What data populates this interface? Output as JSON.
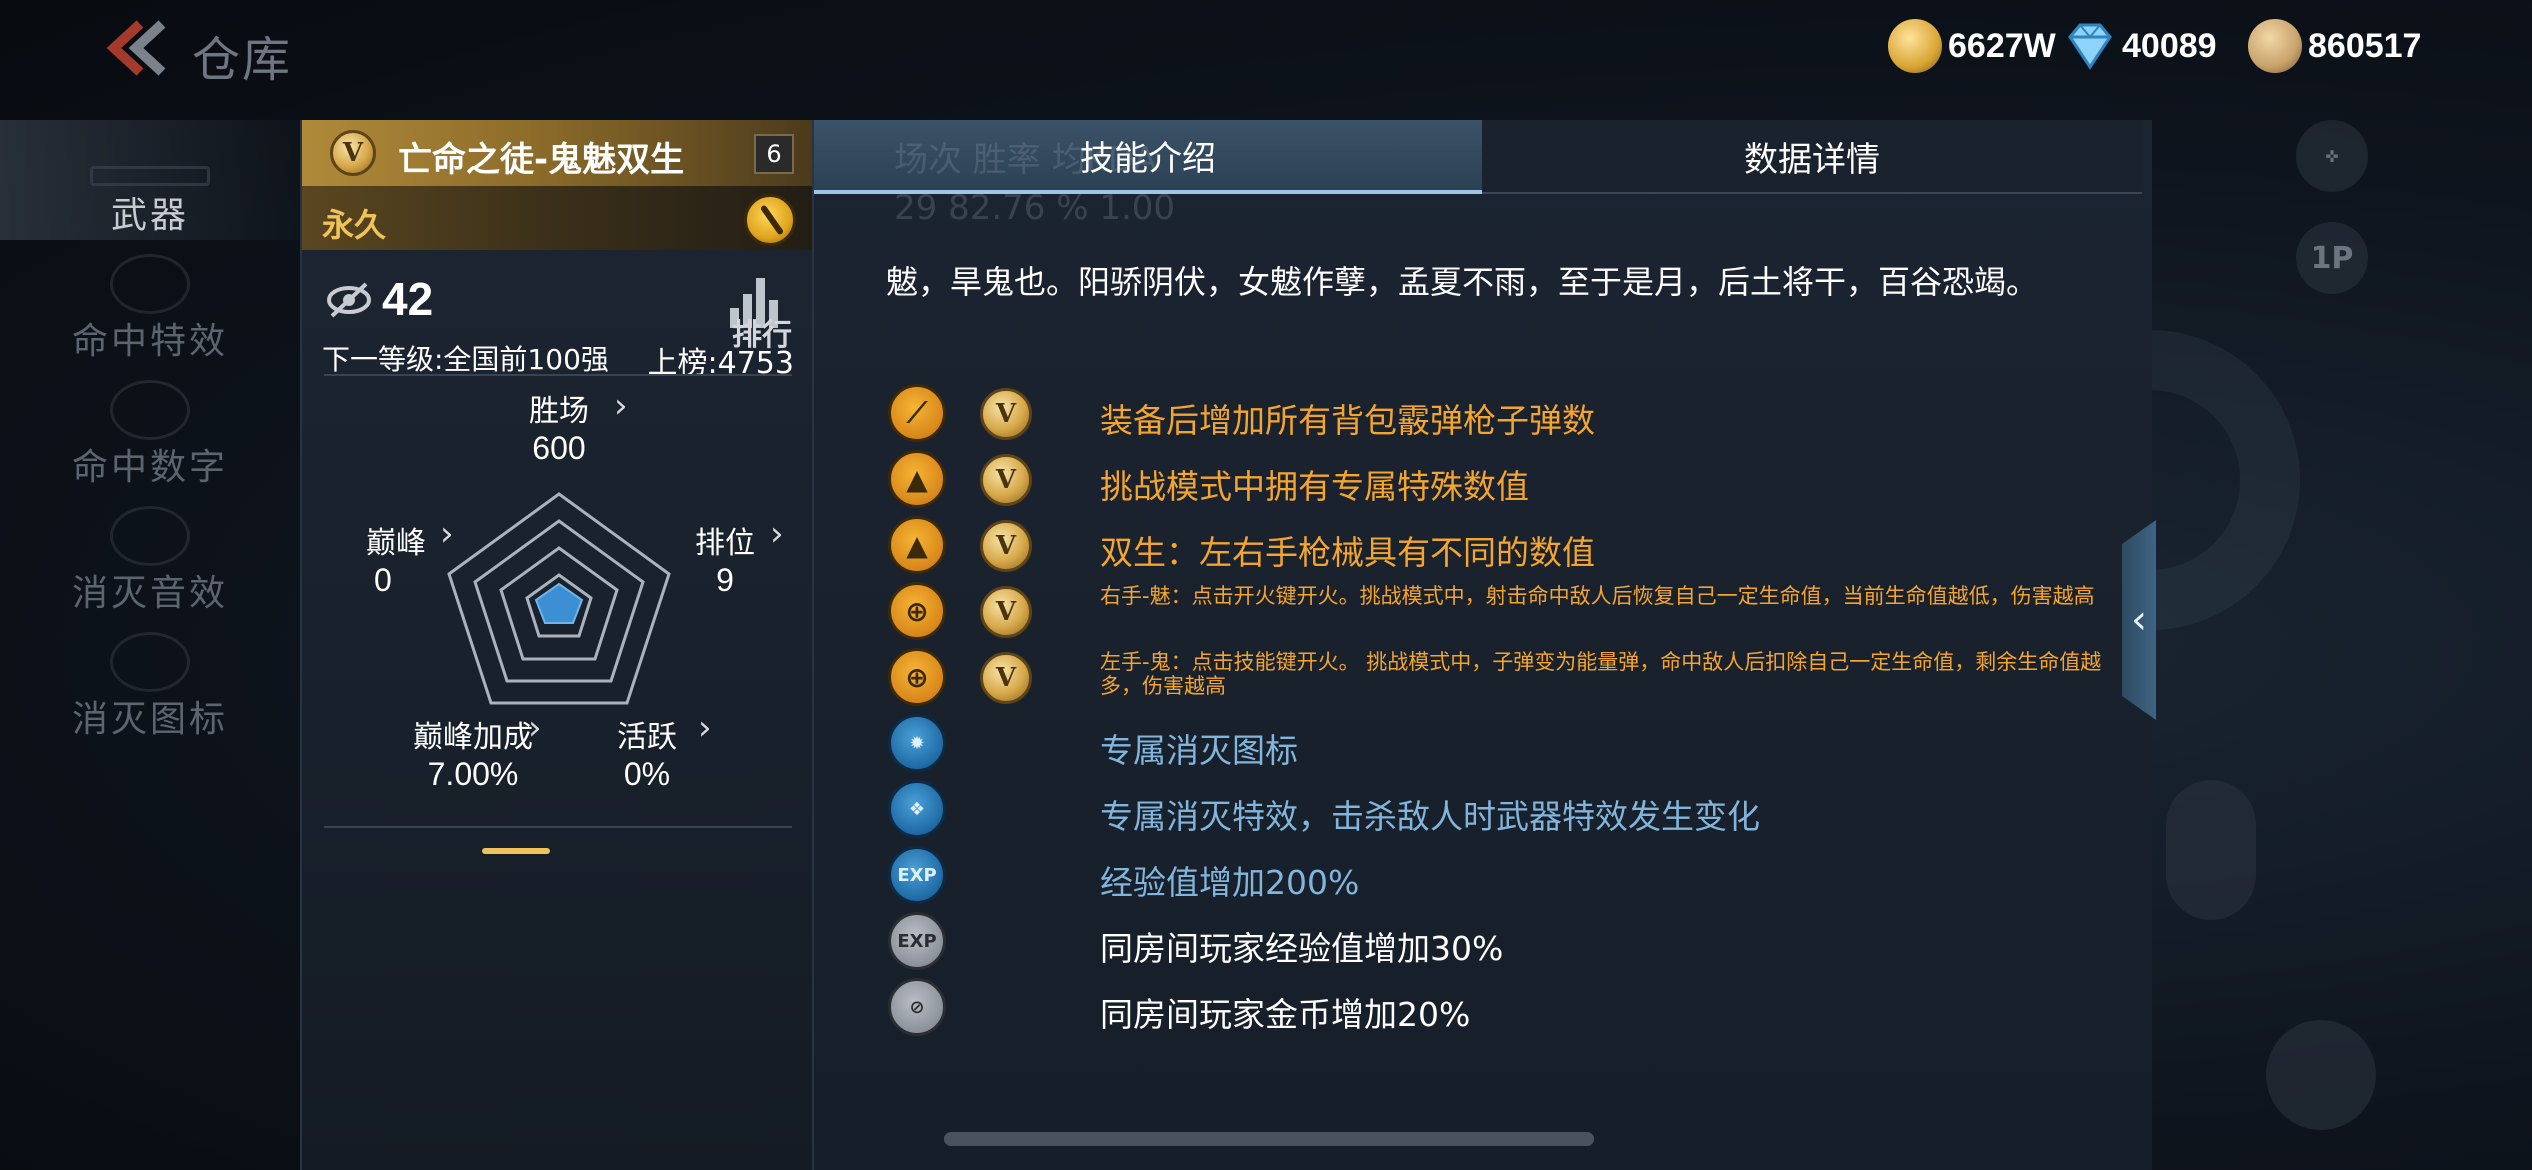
{
  "topbar": {
    "title": "仓库",
    "currencies": [
      {
        "name": "gold",
        "value": "6627W",
        "color": "#d9a636"
      },
      {
        "name": "diamond",
        "value": "40089",
        "color": "#6fc6f4"
      },
      {
        "name": "coin",
        "value": "860517",
        "color": "#c8a26b"
      }
    ]
  },
  "leftnav": {
    "items": [
      {
        "label": "武器"
      },
      {
        "label": "命中特效"
      },
      {
        "label": "命中数字"
      },
      {
        "label": "消灭音效"
      },
      {
        "label": "消灭图标"
      }
    ]
  },
  "card": {
    "badge": "V",
    "name": "亡命之徒-鬼魅双生",
    "level": "6",
    "duration": "永久",
    "rank_score": "42",
    "rank_label": "排行",
    "next_level": "下一等级:全国前100强",
    "on_board": "上榜:4753",
    "radar": {
      "wins": {
        "label": "胜场",
        "value": "600"
      },
      "peak": {
        "label": "巅峰",
        "value": "0"
      },
      "position": {
        "label": "排位",
        "value": "9"
      },
      "peak_bonus": {
        "label": "巅峰加成",
        "value": "7.00%"
      },
      "active": {
        "label": "活跃",
        "value": "0%"
      }
    }
  },
  "panel": {
    "tabs": [
      {
        "label": "技能介绍",
        "active": true
      },
      {
        "label": "数据详情",
        "active": false
      }
    ],
    "behind_text": {
      "headers": "场次          胜率          均KDA",
      "values": "29          82.76 %          1.00"
    },
    "description": "魃，旱鬼也。阳骄阴伏，女魃作孽，孟夏不雨，至于是月，后土将干，百谷恐竭。",
    "features": [
      {
        "icon": "shotgun-icon",
        "style": "orange",
        "has_badge": true,
        "text_style": "orange",
        "size": "normal",
        "text": "装备后增加所有背包霰弹枪子弹数"
      },
      {
        "icon": "challenge-icon",
        "style": "orange",
        "has_badge": true,
        "text_style": "orange",
        "size": "normal",
        "text": "挑战模式中拥有专属特殊数值"
      },
      {
        "icon": "challenge-icon",
        "style": "orange",
        "has_badge": true,
        "text_style": "orange",
        "size": "normal",
        "text": "双生：左右手枪械具有不同的数值"
      },
      {
        "icon": "crosshair-icon",
        "style": "orange",
        "has_badge": true,
        "text_style": "orange",
        "size": "small",
        "text": "右手-魅：点击开火键开火。挑战模式中，射击命中敌人后恢复自己一定生命值，当前生命值越低，伤害越高"
      },
      {
        "icon": "crosshair-icon",
        "style": "orange",
        "has_badge": true,
        "text_style": "orange",
        "size": "small",
        "text": "左手-鬼：点击技能键开火。 挑战模式中，子弹变为能量弹，命中敌人后扣除自己一定生命值，剩余生命值越多，伤害越高"
      },
      {
        "icon": "kill-icon-icon",
        "style": "blue",
        "has_badge": false,
        "text_style": "blue",
        "size": "normal",
        "text": "专属消灭图标"
      },
      {
        "icon": "kill-effect-icon",
        "style": "blue",
        "has_badge": false,
        "text_style": "blue",
        "size": "normal",
        "text": "专属消灭特效，击杀敌人时武器特效发生变化"
      },
      {
        "icon": "exp-icon",
        "style": "blue",
        "has_badge": false,
        "text_style": "blue",
        "size": "normal",
        "text": "经验值增加200%"
      },
      {
        "icon": "exp-icon",
        "style": "grey",
        "has_badge": false,
        "text_style": "white",
        "size": "normal",
        "text": "同房间玩家经验值增加30%"
      },
      {
        "icon": "coin-icon",
        "style": "grey",
        "has_badge": false,
        "text_style": "white",
        "size": "normal",
        "text": "同房间玩家金币增加20%"
      }
    ],
    "exp_glyph": "EXP"
  }
}
